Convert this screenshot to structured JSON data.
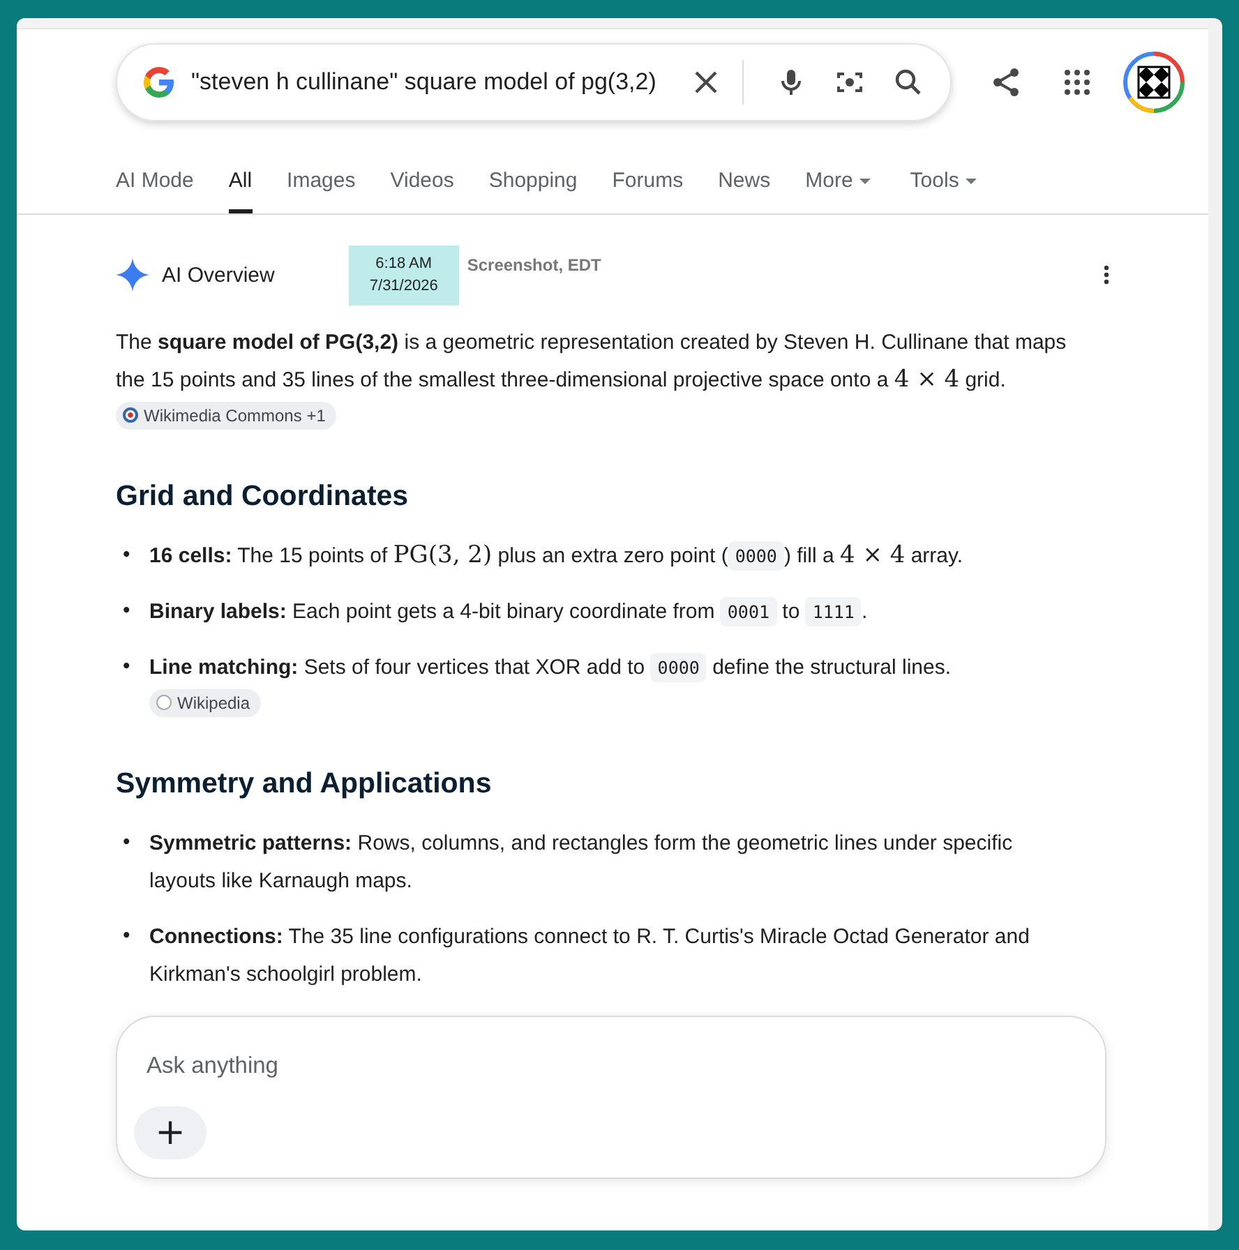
{
  "search": {
    "query": "\"steven h cullinane\" square model of pg(3,2)"
  },
  "tabs": [
    {
      "label": "AI Mode",
      "selected": false,
      "dropdown": false
    },
    {
      "label": "All",
      "selected": true,
      "dropdown": false
    },
    {
      "label": "Images",
      "selected": false,
      "dropdown": false
    },
    {
      "label": "Videos",
      "selected": false,
      "dropdown": false
    },
    {
      "label": "Shopping",
      "selected": false,
      "dropdown": false
    },
    {
      "label": "Forums",
      "selected": false,
      "dropdown": false
    },
    {
      "label": "News",
      "selected": false,
      "dropdown": false
    },
    {
      "label": "More",
      "selected": false,
      "dropdown": true
    },
    {
      "label": "Tools",
      "selected": false,
      "dropdown": true
    }
  ],
  "overview": {
    "label": "AI Overview",
    "stamp": {
      "time": "6:18 AM",
      "date": "7/31/2026",
      "note": "Screenshot, EDT"
    },
    "intro": [
      {
        "kind": "text",
        "text": "The "
      },
      {
        "kind": "bold",
        "text": "square model of PG(3,2)"
      },
      {
        "kind": "text",
        "text": " is a geometric representation created by Steven H. Cullinane that maps the 15 points and 35 lines of the smallest three-dimensional projective space onto a "
      },
      {
        "kind": "math",
        "text": "4 × 4"
      },
      {
        "kind": "text",
        "text": " grid. "
      },
      {
        "kind": "chip",
        "text": "Wikimedia Commons +1"
      }
    ],
    "sections": [
      {
        "heading": "Grid and Coordinates",
        "items": [
          {
            "marker": "•",
            "segments": [
              {
                "kind": "bold",
                "text": "16 cells:"
              },
              {
                "kind": "text",
                "text": " The 15 points of "
              },
              {
                "kind": "math",
                "text": "PG(3, 2)"
              },
              {
                "kind": "text",
                "text": " plus an extra zero point ("
              },
              {
                "kind": "code",
                "text": "0000"
              },
              {
                "kind": "text",
                "text": ") fill a "
              },
              {
                "kind": "math",
                "text": "4 × 4"
              },
              {
                "kind": "text",
                "text": " array."
              }
            ]
          },
          {
            "marker": "•",
            "segments": [
              {
                "kind": "bold",
                "text": "Binary labels:"
              },
              {
                "kind": "text",
                "text": " Each point gets a 4-bit binary coordinate from "
              },
              {
                "kind": "code",
                "text": "0001"
              },
              {
                "kind": "text",
                "text": " to "
              },
              {
                "kind": "code",
                "text": "1111"
              },
              {
                "kind": "text",
                "text": "."
              }
            ]
          },
          {
            "marker": "•",
            "segments": [
              {
                "kind": "bold",
                "text": "Line matching:"
              },
              {
                "kind": "text",
                "text": " Sets of four vertices that XOR add to "
              },
              {
                "kind": "code",
                "text": "0000"
              },
              {
                "kind": "text",
                "text": " define the structural lines. "
              },
              {
                "kind": "chip",
                "text": "Wikipedia"
              }
            ]
          }
        ]
      },
      {
        "heading": "Symmetry and Applications",
        "items": [
          {
            "marker": "•",
            "segments": [
              {
                "kind": "bold",
                "text": "Symmetric patterns:"
              },
              {
                "kind": "text",
                "text": " Rows, columns, and rectangles form the geometric lines under specific layouts like Karnaugh maps."
              }
            ]
          },
          {
            "marker": "•",
            "segments": [
              {
                "kind": "bold",
                "text": "Connections:"
              },
              {
                "kind": "text",
                "text": " The 35 line configurations connect to R. T. Curtis's Miracle Octad Generator and Kirkman's schoolgirl problem."
              }
            ]
          }
        ]
      }
    ]
  },
  "ask": {
    "placeholder": "Ask anything",
    "plus": "+"
  }
}
